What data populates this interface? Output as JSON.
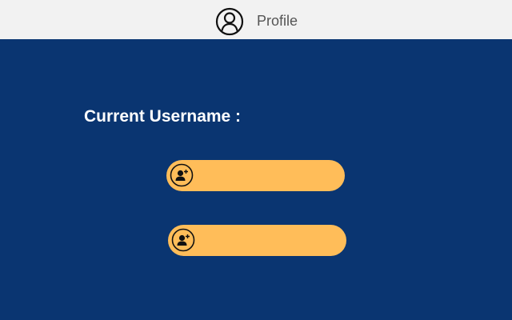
{
  "header": {
    "icon": "profile-circle-icon",
    "title": "Profile"
  },
  "main": {
    "username_label": "Current Username :",
    "buttons": [
      {
        "icon": "add-user-icon",
        "label": ""
      },
      {
        "icon": "add-user-icon",
        "label": ""
      }
    ]
  },
  "colors": {
    "header_bg": "#f2f2f2",
    "main_bg": "#0a3571",
    "button_bg": "#ffbd59",
    "heading_text": "#ffffff"
  }
}
